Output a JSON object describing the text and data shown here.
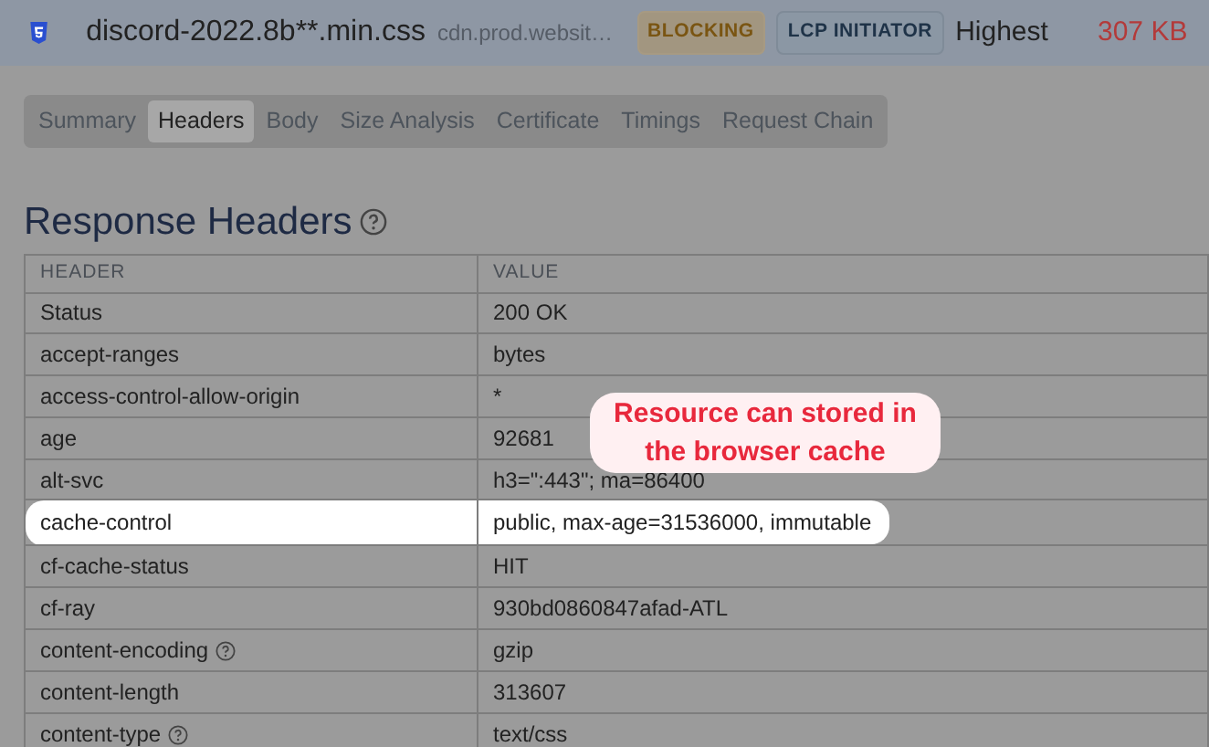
{
  "request": {
    "file": "discord-2022.8b**.min.css",
    "host": "cdn.prod.websit…",
    "priority": "Highest",
    "size": "307 KB"
  },
  "badges": [
    {
      "label": "BLOCKING",
      "kind": "warning"
    },
    {
      "label": "LCP INITIATOR",
      "kind": "info"
    }
  ],
  "tabs": [
    {
      "label": "Summary",
      "selected": false
    },
    {
      "label": "Headers",
      "selected": true
    },
    {
      "label": "Body",
      "selected": false
    },
    {
      "label": "Size Analysis",
      "selected": false
    },
    {
      "label": "Certificate",
      "selected": false
    },
    {
      "label": "Timings",
      "selected": false
    },
    {
      "label": "Request Chain",
      "selected": false
    }
  ],
  "section": {
    "title": "Response Headers",
    "help": true
  },
  "table": {
    "columns": [
      "HEADER",
      "VALUE"
    ],
    "rows": [
      {
        "header": "Status",
        "value": "200 OK",
        "help": false,
        "highlighted": false
      },
      {
        "header": "accept-ranges",
        "value": "bytes",
        "help": false,
        "highlighted": false
      },
      {
        "header": "access-control-allow-origin",
        "value": "*",
        "help": false,
        "highlighted": false
      },
      {
        "header": "age",
        "value": "92681",
        "help": false,
        "highlighted": false
      },
      {
        "header": "alt-svc",
        "value": "h3=\":443\"; ma=86400",
        "help": false,
        "highlighted": false
      },
      {
        "header": "cache-control",
        "value": "public, max-age=31536000, immutable",
        "help": false,
        "highlighted": true
      },
      {
        "header": "cf-cache-status",
        "value": "HIT",
        "help": false,
        "highlighted": false
      },
      {
        "header": "cf-ray",
        "value": "930bd0860847afad-ATL",
        "help": false,
        "highlighted": false
      },
      {
        "header": "content-encoding",
        "value": "gzip",
        "help": true,
        "highlighted": false
      },
      {
        "header": "content-length",
        "value": "313607",
        "help": false,
        "highlighted": false
      },
      {
        "header": "content-type",
        "value": "text/css",
        "help": true,
        "highlighted": false
      }
    ]
  },
  "callout": {
    "text": "Resource can stored in the browser cache"
  }
}
